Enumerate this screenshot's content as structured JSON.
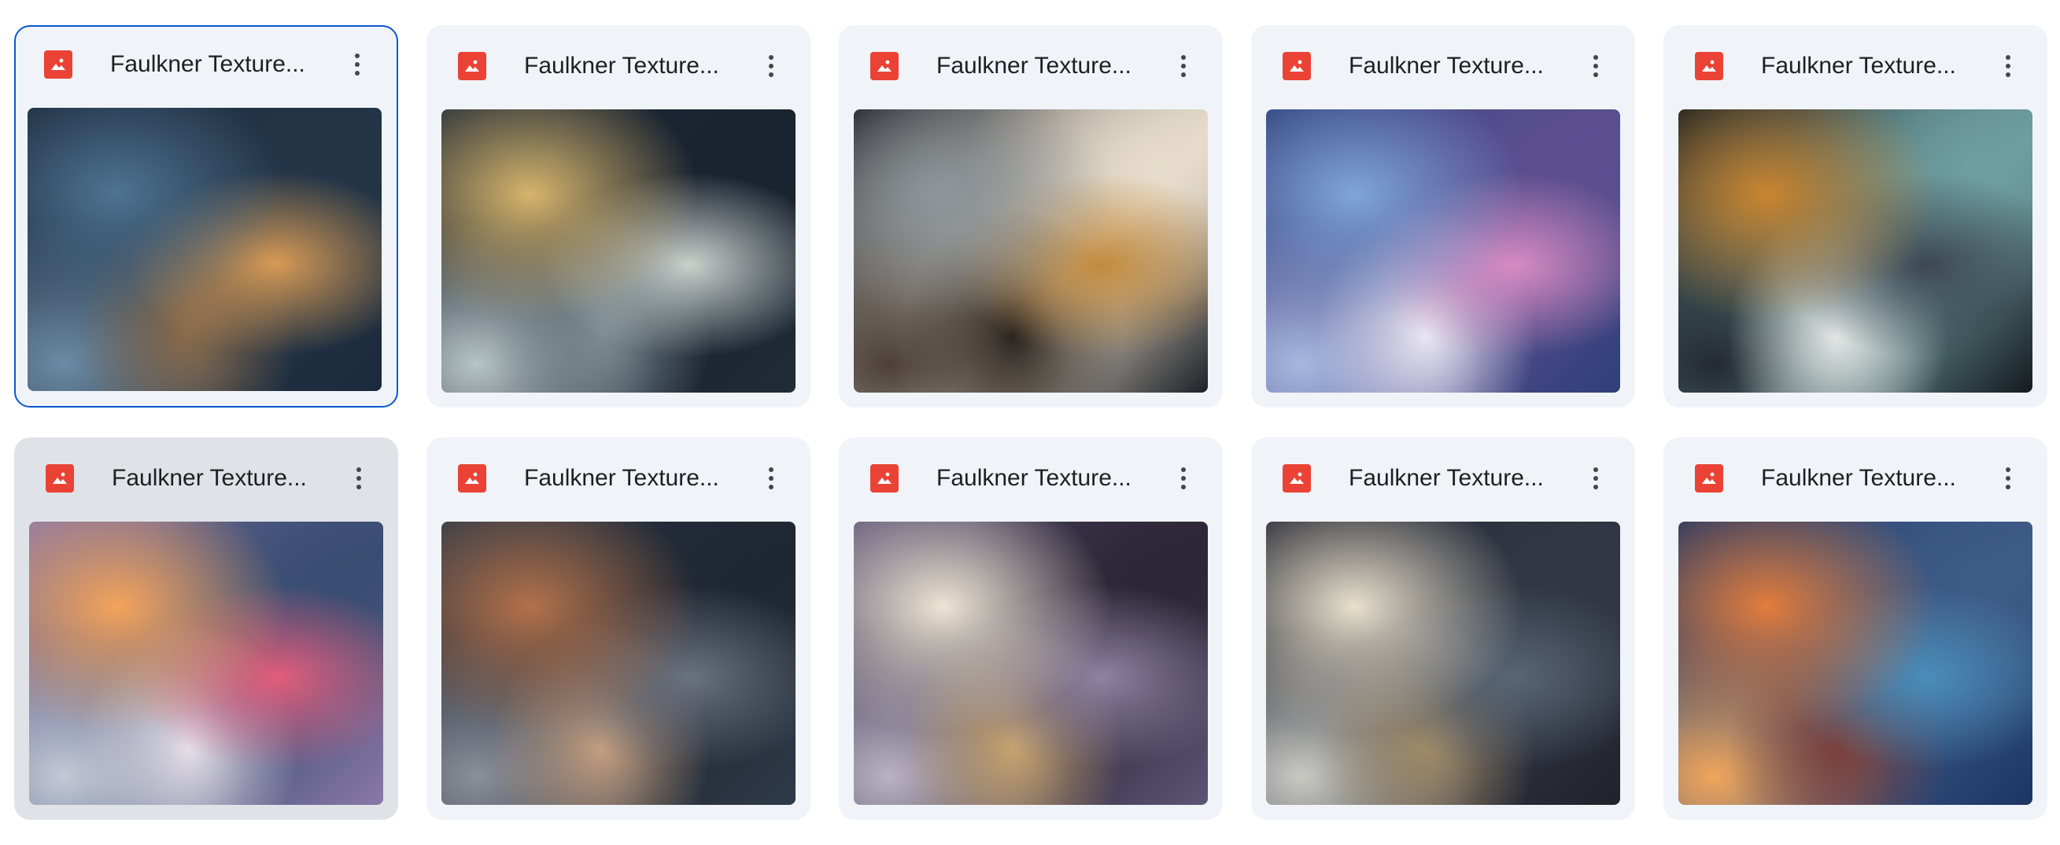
{
  "files": [
    {
      "title": "Faulkner Texture...",
      "type_icon": "image-file-icon",
      "state": "selected",
      "colors": [
        "#1b2a3c",
        "#4f7391",
        "#d79a55",
        "#8a6a4a",
        "#233547",
        "#6c8aa3"
      ]
    },
    {
      "title": "Faulkner Texture...",
      "type_icon": "image-file-icon",
      "state": "normal",
      "colors": [
        "#202b37",
        "#d6b46c",
        "#c9d1cc",
        "#7c8b92",
        "#1a2330",
        "#b7c4c6"
      ]
    },
    {
      "title": "Faulkner Texture...",
      "type_icon": "image-file-icon",
      "state": "normal",
      "colors": [
        "#1d2128",
        "#8f979b",
        "#c28a3d",
        "#2a231e",
        "#e7dccb",
        "#4c4038"
      ]
    },
    {
      "title": "Faulkner Texture...",
      "type_icon": "image-file-icon",
      "state": "normal",
      "colors": [
        "#2e3f78",
        "#7fa5d8",
        "#d88bc2",
        "#e9e7f2",
        "#5c4f90",
        "#a5b8df"
      ]
    },
    {
      "title": "Faulkner Texture...",
      "type_icon": "image-file-icon",
      "state": "normal",
      "colors": [
        "#151a20",
        "#c9852f",
        "#3d4752",
        "#e4e7e5",
        "#6e9ea0",
        "#242a31"
      ]
    },
    {
      "title": "Faulkner Texture...",
      "type_icon": "image-file-icon",
      "state": "hovered",
      "colors": [
        "#8b78a8",
        "#f3a35a",
        "#e35d7c",
        "#e6dfe8",
        "#394d72",
        "#c3c9d6"
      ]
    },
    {
      "title": "Faulkner Texture...",
      "type_icon": "image-file-icon",
      "state": "normal",
      "colors": [
        "#2f3a48",
        "#b3714a",
        "#6b7280",
        "#c49e80",
        "#1f2733",
        "#8b8f9a"
      ]
    },
    {
      "title": "Faulkner Texture...",
      "type_icon": "image-file-icon",
      "state": "normal",
      "colors": [
        "#5e5577",
        "#ece4d3",
        "#8e83a3",
        "#c8a46f",
        "#2c2636",
        "#b9b2c4"
      ]
    },
    {
      "title": "Faulkner Texture...",
      "type_icon": "image-file-icon",
      "state": "normal",
      "colors": [
        "#20222c",
        "#e8e0cc",
        "#596676",
        "#a08a67",
        "#313744",
        "#c9c9c3"
      ]
    },
    {
      "title": "Faulkner Texture...",
      "type_icon": "image-file-icon",
      "state": "normal",
      "colors": [
        "#1b3464",
        "#e27c3c",
        "#4b8db9",
        "#7b3f3a",
        "#3e5a86",
        "#f0a55b"
      ]
    }
  ],
  "accent_color": "#0b57d0",
  "file_type_color": "#ea4335",
  "more_icon": "more-vertical-icon"
}
